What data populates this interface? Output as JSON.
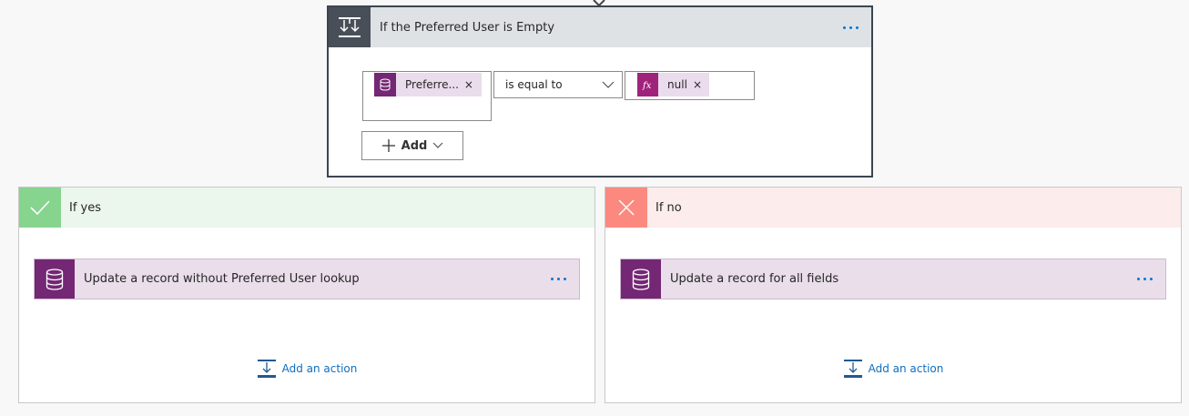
{
  "condition": {
    "title": "If the Preferred User is Empty",
    "left_token": "Preferre...",
    "operator": "is equal to",
    "right_token": "null",
    "remove_glyph": "×",
    "add_label": "Add"
  },
  "branches": {
    "yes": {
      "label": "If yes",
      "action_title": "Update a record without Preferred User lookup",
      "add_action_label": "Add an action"
    },
    "no": {
      "label": "If no",
      "action_title": "Update a record for all fields",
      "add_action_label": "Add an action"
    }
  },
  "icons": {
    "condition": "condition-icon",
    "dataverse": "database-icon",
    "expression": "fx-icon",
    "check": "check-icon",
    "close": "close-icon",
    "more": "more-options-icon",
    "add_action": "add-action-icon"
  },
  "colors": {
    "dataverse_purple": "#742774",
    "token_bg": "#eadcec",
    "yes_green": "#86d48e",
    "no_red": "#fb8980",
    "link_blue": "#106ebe"
  }
}
